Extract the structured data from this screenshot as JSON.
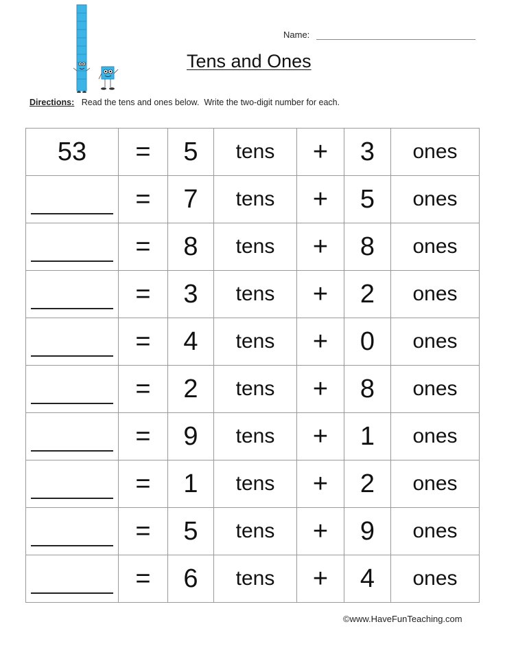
{
  "header": {
    "name_label": "Name:",
    "title": "Tens and Ones",
    "directions_label": "Directions:",
    "directions_text": "   Read the tens and ones below.  Write the two-digit number for each."
  },
  "illustration": {
    "icon": "base-ten-blocks-mascots-icon",
    "color": "#3cb4e6"
  },
  "problems": [
    {
      "answer": "53",
      "eq": "=",
      "tens": "5",
      "tens_label": "tens",
      "plus": "+",
      "ones": "3",
      "ones_label": "ones"
    },
    {
      "answer": "",
      "eq": "=",
      "tens": "7",
      "tens_label": "tens",
      "plus": "+",
      "ones": "5",
      "ones_label": "ones"
    },
    {
      "answer": "",
      "eq": "=",
      "tens": "8",
      "tens_label": "tens",
      "plus": "+",
      "ones": "8",
      "ones_label": "ones"
    },
    {
      "answer": "",
      "eq": "=",
      "tens": "3",
      "tens_label": "tens",
      "plus": "+",
      "ones": "2",
      "ones_label": "ones"
    },
    {
      "answer": "",
      "eq": "=",
      "tens": "4",
      "tens_label": "tens",
      "plus": "+",
      "ones": "0",
      "ones_label": "ones"
    },
    {
      "answer": "",
      "eq": "=",
      "tens": "2",
      "tens_label": "tens",
      "plus": "+",
      "ones": "8",
      "ones_label": "ones"
    },
    {
      "answer": "",
      "eq": "=",
      "tens": "9",
      "tens_label": "tens",
      "plus": "+",
      "ones": "1",
      "ones_label": "ones"
    },
    {
      "answer": "",
      "eq": "=",
      "tens": "1",
      "tens_label": "tens",
      "plus": "+",
      "ones": "2",
      "ones_label": "ones"
    },
    {
      "answer": "",
      "eq": "=",
      "tens": "5",
      "tens_label": "tens",
      "plus": "+",
      "ones": "9",
      "ones_label": "ones"
    },
    {
      "answer": "",
      "eq": "=",
      "tens": "6",
      "tens_label": "tens",
      "plus": "+",
      "ones": "4",
      "ones_label": "ones"
    }
  ],
  "footer": {
    "copyright": "©www.HaveFunTeaching.com"
  }
}
